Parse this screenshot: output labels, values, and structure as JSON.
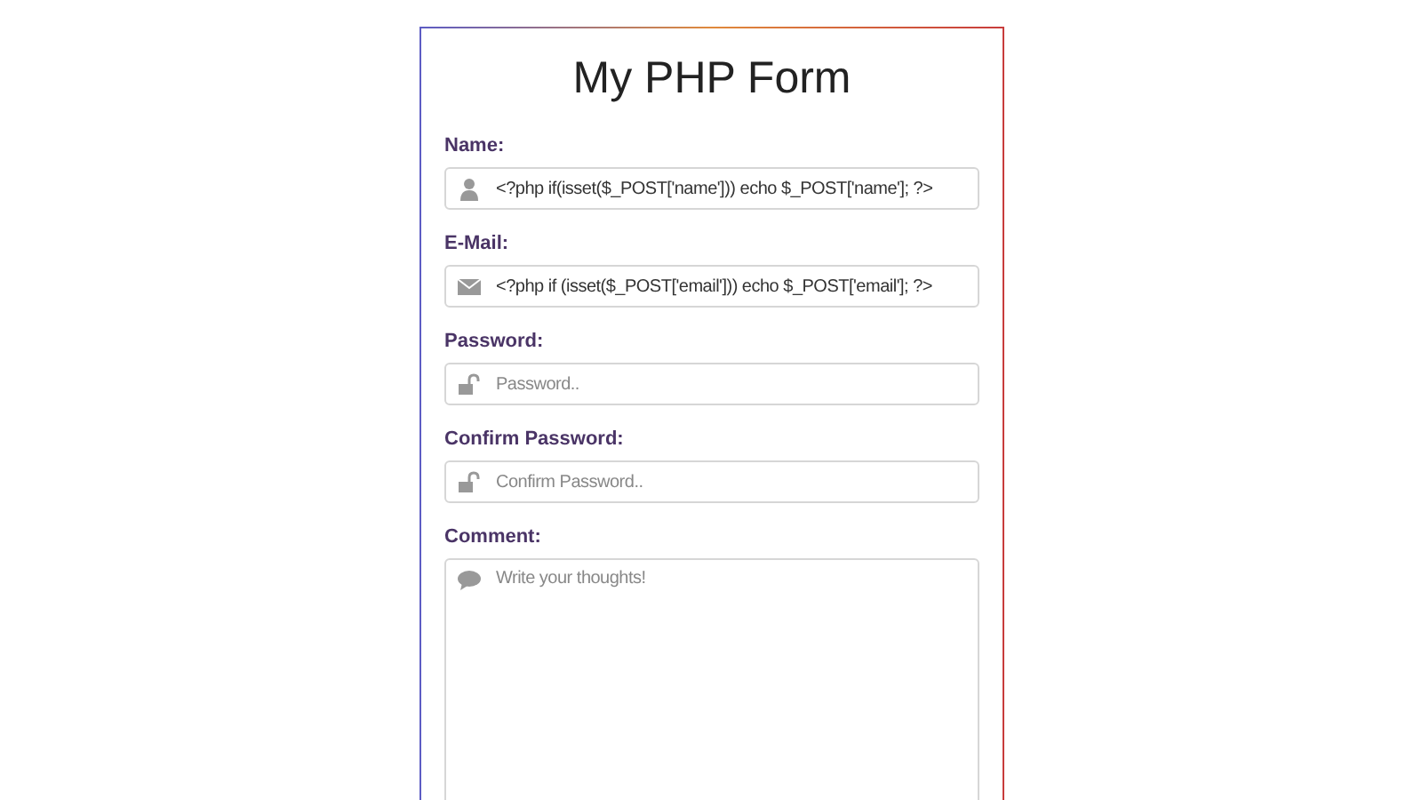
{
  "form": {
    "title": "My PHP Form",
    "fields": [
      {
        "label": "Name:",
        "kind": "text",
        "value": "<?php if(isset($_POST['name'])) echo $_POST['name']; ?>"
      },
      {
        "label": "E-Mail:",
        "kind": "text",
        "value": "<?php if (isset($_POST['email'])) echo $_POST['email']; ?>"
      },
      {
        "label": "Password:",
        "kind": "text",
        "placeholder": "Password.."
      },
      {
        "label": "Confirm Password:",
        "kind": "text",
        "placeholder": "Confirm Password.."
      },
      {
        "label": "Comment:",
        "kind": "textarea",
        "placeholder": "Write your thoughts!"
      }
    ]
  }
}
